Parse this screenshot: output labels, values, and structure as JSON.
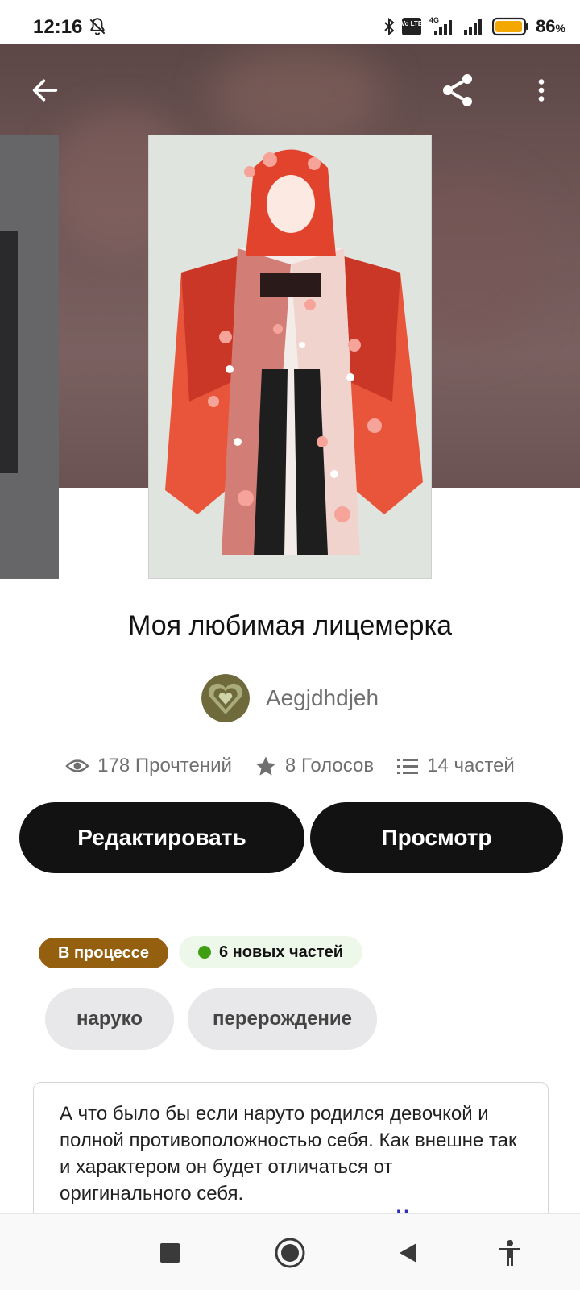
{
  "status_bar": {
    "time": "12:16",
    "icons": [
      "mute-bell-icon",
      "bluetooth-icon",
      "volte-icon",
      "signal-4g-icon",
      "signal-icon",
      "battery-icon"
    ],
    "network_label": "4G",
    "volte_label": "Vo LTE",
    "battery_percent": "86",
    "battery_unit": "%",
    "battery_color": "#f2a800"
  },
  "header": {
    "icons": [
      "back-arrow-icon",
      "share-icon",
      "more-vertical-icon"
    ]
  },
  "story": {
    "title": "Моя любимая лицемерка",
    "author": "Aegjdhdjeh",
    "stats": {
      "reads": "178 Прочтений",
      "votes": "8 Голосов",
      "parts": "14 частей"
    },
    "buttons": {
      "edit": "Редактировать",
      "view": "Просмотр"
    },
    "status_badge": "В процессе",
    "status_color": "#955f10",
    "new_parts": "6 новых частей",
    "new_parts_dot_color": "#3f9e12",
    "tags": [
      "наруко",
      "перерождение"
    ],
    "description": "А что было бы если наруто родился девочкой и полной противоположностью себя.  Как внешне так и характером он будет отличаться от оригинального себя.",
    "read_more": "Читать далее"
  },
  "nav_bar": {
    "icons": [
      "recent-apps-icon",
      "home-icon",
      "back-triangle-icon",
      "accessibility-icon"
    ]
  }
}
